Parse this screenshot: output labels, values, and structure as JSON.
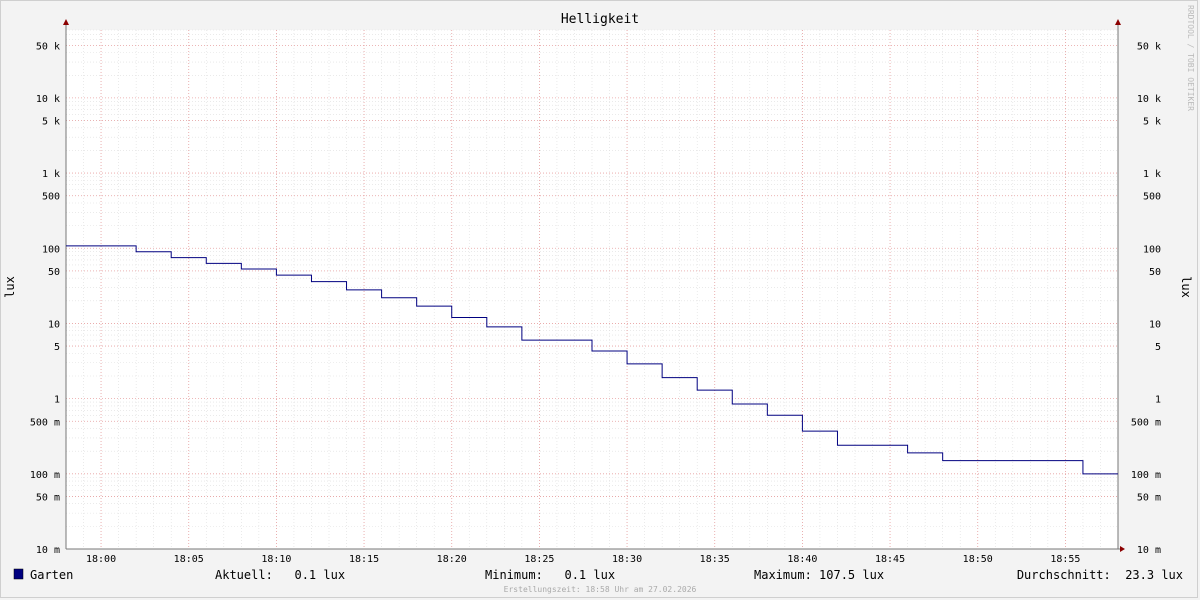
{
  "chart_data": {
    "type": "line",
    "title": "Helligkeit",
    "ylabel": "lux",
    "yscale": "log",
    "ylim": [
      0.01,
      80000
    ],
    "y_ticks": [
      {
        "value": 50000,
        "label": "50 k"
      },
      {
        "value": 10000,
        "label": "10 k"
      },
      {
        "value": 5000,
        "label": "5 k"
      },
      {
        "value": 1000,
        "label": "1 k"
      },
      {
        "value": 500,
        "label": "500"
      },
      {
        "value": 100,
        "label": "100"
      },
      {
        "value": 50,
        "label": "50"
      },
      {
        "value": 10,
        "label": "10"
      },
      {
        "value": 5,
        "label": "5"
      },
      {
        "value": 1,
        "label": "1"
      },
      {
        "value": 0.5,
        "label": "500 m"
      },
      {
        "value": 0.1,
        "label": "100 m"
      },
      {
        "value": 0.05,
        "label": "50 m"
      },
      {
        "value": 0.01,
        "label": "10 m"
      }
    ],
    "xlim": [
      "17:58",
      "18:58"
    ],
    "x_ticks": [
      "18:00",
      "18:05",
      "18:10",
      "18:15",
      "18:20",
      "18:25",
      "18:30",
      "18:35",
      "18:40",
      "18:45",
      "18:50",
      "18:55"
    ],
    "grid": true,
    "series": [
      {
        "name": "Garten",
        "color": "#000080",
        "steps": [
          {
            "x": "17:58",
            "y": 107.5
          },
          {
            "x": "18:02",
            "y": 90
          },
          {
            "x": "18:04",
            "y": 75
          },
          {
            "x": "18:06",
            "y": 63
          },
          {
            "x": "18:08",
            "y": 53
          },
          {
            "x": "18:10",
            "y": 44
          },
          {
            "x": "18:12",
            "y": 36
          },
          {
            "x": "18:14",
            "y": 28
          },
          {
            "x": "18:16",
            "y": 22
          },
          {
            "x": "18:18",
            "y": 17
          },
          {
            "x": "18:20",
            "y": 12
          },
          {
            "x": "18:22",
            "y": 9
          },
          {
            "x": "18:24",
            "y": 6
          },
          {
            "x": "18:28",
            "y": 4.3
          },
          {
            "x": "18:30",
            "y": 2.9
          },
          {
            "x": "18:32",
            "y": 1.9
          },
          {
            "x": "18:34",
            "y": 1.3
          },
          {
            "x": "18:36",
            "y": 0.85
          },
          {
            "x": "18:38",
            "y": 0.6
          },
          {
            "x": "18:40",
            "y": 0.37
          },
          {
            "x": "18:42",
            "y": 0.24
          },
          {
            "x": "18:46",
            "y": 0.19
          },
          {
            "x": "18:48",
            "y": 0.15
          },
          {
            "x": "18:56",
            "y": 0.1
          },
          {
            "x": "18:58",
            "y": 0.1
          }
        ]
      }
    ]
  },
  "legend": {
    "series_name": "Garten",
    "current": "Aktuell:   0.1 lux",
    "minimum": "Minimum:   0.1 lux",
    "maximum": "Maximum: 107.5 lux",
    "average": "Durchschnitt:  23.3 lux"
  },
  "footer": "Erstellungszeit: 18:58 Uhr am 27.02.2026",
  "watermark": "RRDTOOL / TOBI OETIKER"
}
